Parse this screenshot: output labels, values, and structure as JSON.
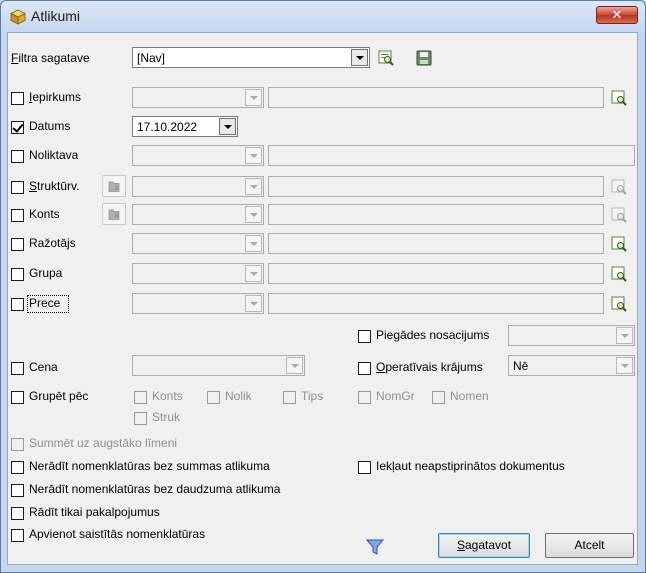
{
  "window": {
    "title": "Atlikumi",
    "close": "✕"
  },
  "filter": {
    "label": "Filtra sagatave",
    "underline": "F",
    "rest": "iltra sagatave",
    "value": "[Nav]"
  },
  "rows": {
    "iepirkums": {
      "u": "I",
      "rest": "epirkums"
    },
    "datums": {
      "label": "Datums",
      "date": "17.10.2022"
    },
    "noliktava": {
      "label": "Noliktava"
    },
    "strukturv": {
      "u": "S",
      "rest": "truktūrv."
    },
    "konts": {
      "label": "Konts"
    },
    "razotajs": {
      "label": "Ražotājs"
    },
    "grupa": {
      "label": "Grupa"
    },
    "prece": {
      "label": "Prece"
    }
  },
  "piegades": {
    "label": "Piegādes nosacijums"
  },
  "cena": {
    "label": "Cena"
  },
  "operativais": {
    "u": "O",
    "rest": "peratīvais krājums",
    "value": "Nē"
  },
  "grupet": {
    "label": "Grupēt pēc",
    "options": [
      "Konts",
      "Nolik",
      "Tips",
      "NomGr",
      "Nomen",
      "Struk"
    ]
  },
  "options": {
    "summet": "Summēt uz augstāko līmeni",
    "neradit_summas": "Nerādīt nomenklatūras bez summas atlikuma",
    "neradit_daudzuma": "Nerādīt nomenklatūras bez daudzuma atlikuma",
    "radit_pakalpojumus": "Rādīt tikai pakalpojumus",
    "apvienot": "Apvienot saistītās nomenklatūras",
    "ieklaut": "Iekļaut neapstiprinātos dokumentus"
  },
  "buttons": {
    "sagatavot_u": "S",
    "sagatavot_rest": "agatavot",
    "atcelt": "Atcelt"
  },
  "colors": {
    "accent": "#5a7da8",
    "close": "#c8473a"
  }
}
